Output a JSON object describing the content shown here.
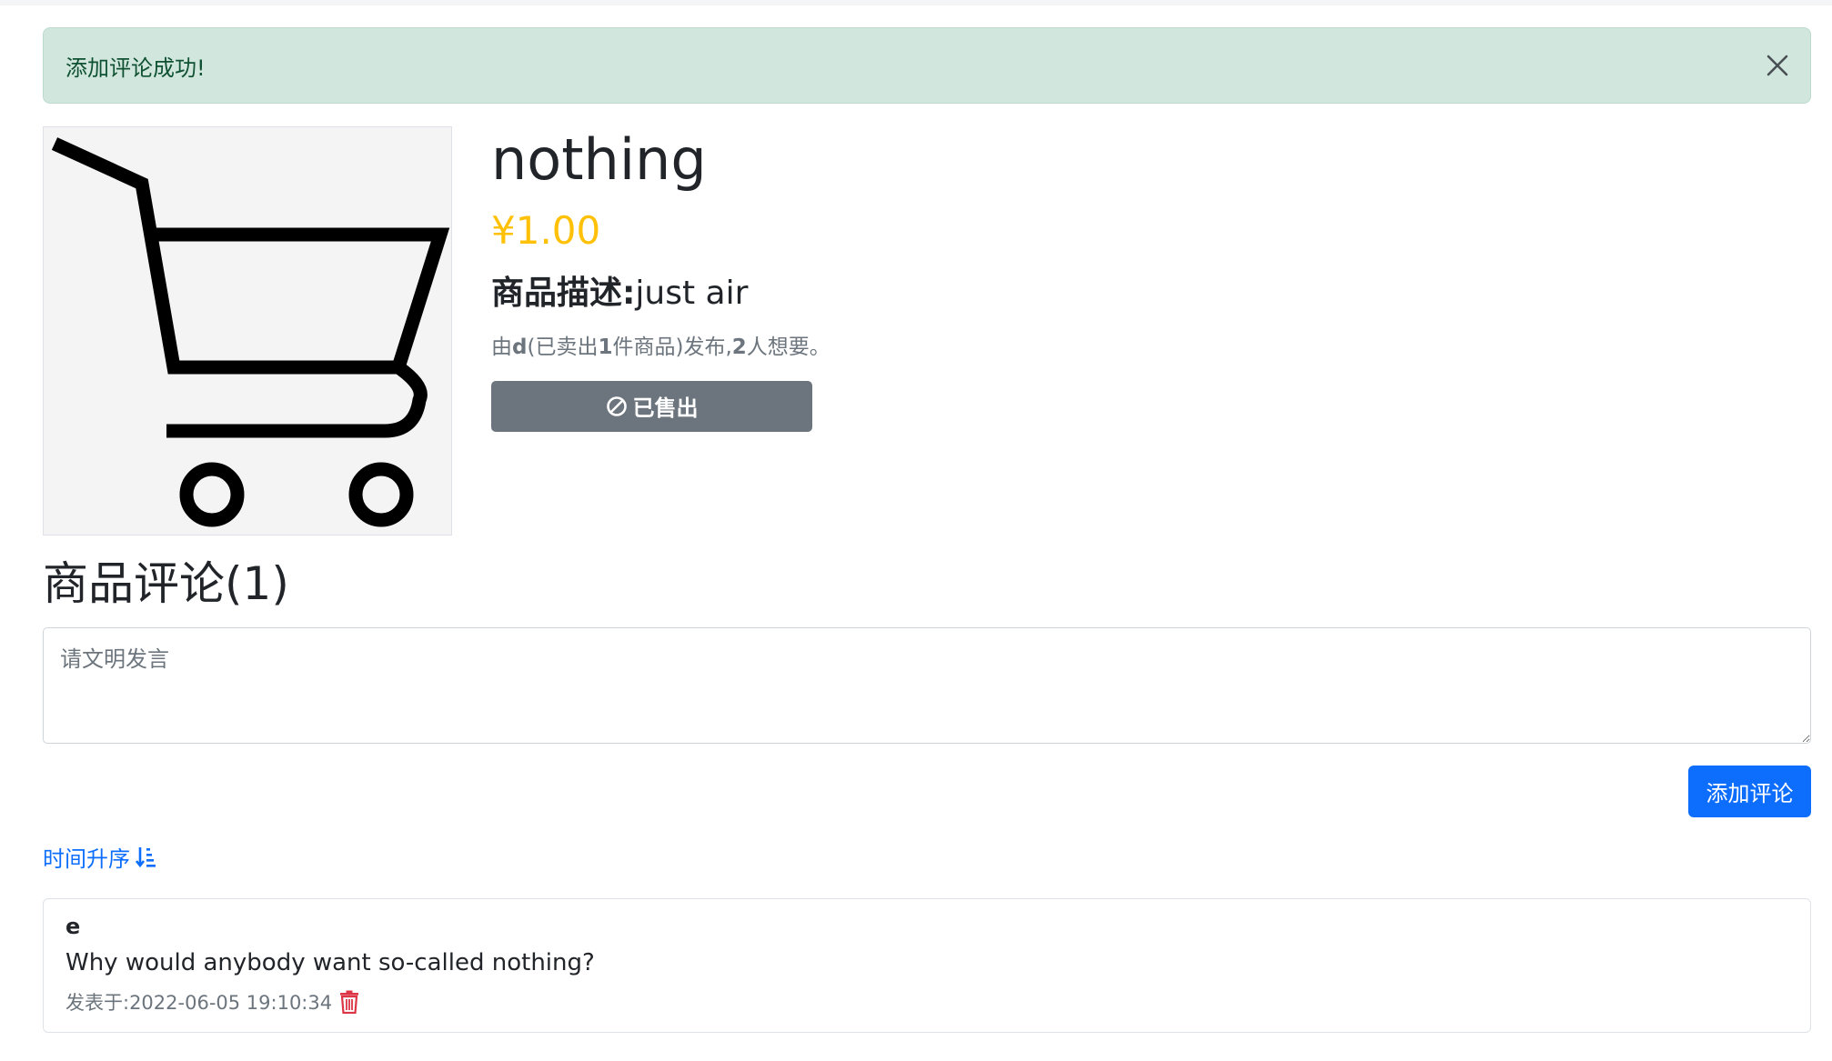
{
  "alert": {
    "message": "添加评论成功!",
    "close_icon": "close-icon"
  },
  "product": {
    "image_icon": "shopping-cart-icon",
    "name": "nothing",
    "price": "¥1.00",
    "description_label": "商品描述:",
    "description": "just air",
    "meta": {
      "prefix": "由",
      "seller": "d",
      "sold_prefix": "(已卖出",
      "sold_count": "1",
      "sold_suffix": "件商品)发布,",
      "want_count": "2",
      "want_suffix": "人想要。"
    },
    "status_button": {
      "icon": "ban-icon",
      "label": "已售出"
    }
  },
  "comments": {
    "title": "商品评论(1)",
    "input_placeholder": "请文明发言",
    "input_value": "",
    "add_button_label": "添加评论",
    "sort_label": "时间升序",
    "sort_icon": "sort-numeric-down-icon",
    "items": [
      {
        "author": "e",
        "body": "Why would anybody want so-called nothing?",
        "time": "发表于:2022-06-05 19:10:34",
        "delete_icon": "trash-icon"
      }
    ]
  },
  "colors": {
    "alert_bg": "#d1e7dd",
    "alert_text": "#0f5132",
    "price": "#ffc107",
    "primary": "#0d6efd",
    "secondary": "#6c757d",
    "danger": "#dc3545"
  }
}
